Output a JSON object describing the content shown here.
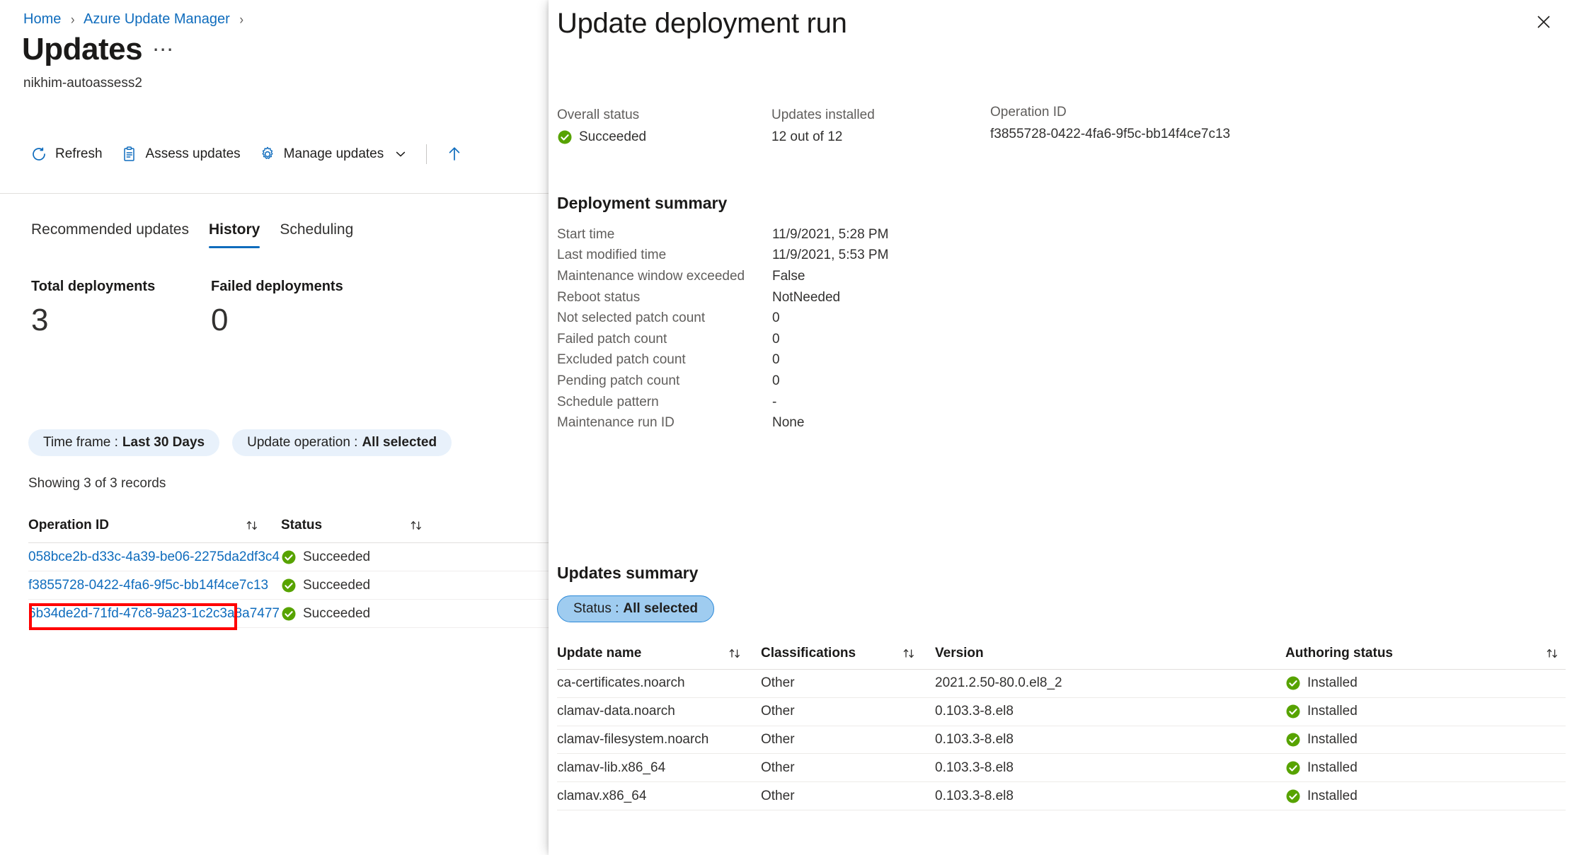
{
  "breadcrumb": {
    "items": [
      "Home",
      "Azure Update Manager"
    ],
    "separator": "›"
  },
  "page": {
    "title": "Updates",
    "ellipsis": "⋯",
    "subtitle": "nikhim-autoassess2"
  },
  "command_bar": {
    "refresh": "Refresh",
    "assess_updates": "Assess updates",
    "manage_updates": "Manage updates"
  },
  "tabs": [
    {
      "label": "Recommended updates",
      "active": false
    },
    {
      "label": "History",
      "active": true
    },
    {
      "label": "Scheduling",
      "active": false
    }
  ],
  "metrics": [
    {
      "label": "Total deployments",
      "value": "3"
    },
    {
      "label": "Failed deployments",
      "value": "0"
    }
  ],
  "filters": [
    {
      "key": "Time frame :",
      "value": "Last 30 Days"
    },
    {
      "key": "Update operation :",
      "value": "All selected"
    }
  ],
  "records_text": "Showing 3 of 3 records",
  "history_table": {
    "columns": [
      "Operation ID",
      "Status"
    ],
    "rows": [
      {
        "operation_id": "058bce2b-d33c-4a39-be06-2275da2df3c4",
        "status": "Succeeded",
        "highlighted": false
      },
      {
        "operation_id": "f3855728-0422-4fa6-9f5c-bb14f4ce7c13",
        "status": "Succeeded",
        "highlighted": true
      },
      {
        "operation_id": "6b34de2d-71fd-47c8-9a23-1c2c3a8a7477",
        "status": "Succeeded",
        "highlighted": false
      }
    ]
  },
  "panel": {
    "title": "Update deployment run",
    "close_label": "Close",
    "status_strip": {
      "overall_status_label": "Overall status",
      "overall_status_value": "Succeeded",
      "updates_installed_label": "Updates installed",
      "updates_installed_value": "12 out of 12",
      "operation_id_label": "Operation ID",
      "operation_id_value": "f3855728-0422-4fa6-9f5c-bb14f4ce7c13"
    },
    "deployment_summary": {
      "heading": "Deployment summary",
      "rows": [
        {
          "key": "Start time",
          "value": "11/9/2021, 5:28 PM"
        },
        {
          "key": "Last modified time",
          "value": "11/9/2021, 5:53 PM"
        },
        {
          "key": "Maintenance window exceeded",
          "value": "False"
        },
        {
          "key": "Reboot status",
          "value": "NotNeeded"
        },
        {
          "key": "Not selected patch count",
          "value": "0"
        },
        {
          "key": "Failed patch count",
          "value": "0"
        },
        {
          "key": "Excluded patch count",
          "value": "0"
        },
        {
          "key": "Pending patch count",
          "value": "0"
        },
        {
          "key": "Schedule pattern",
          "value": "-"
        },
        {
          "key": "Maintenance run ID",
          "value": "None"
        }
      ]
    },
    "updates_summary": {
      "heading": "Updates summary",
      "filter": {
        "key": "Status :",
        "value": "All selected"
      },
      "columns": [
        "Update name",
        "Classifications",
        "Version",
        "Authoring status"
      ],
      "rows": [
        {
          "name": "ca-certificates.noarch",
          "classification": "Other",
          "version": "2021.2.50-80.0.el8_2",
          "authoring_status": "Installed"
        },
        {
          "name": "clamav-data.noarch",
          "classification": "Other",
          "version": "0.103.3-8.el8",
          "authoring_status": "Installed"
        },
        {
          "name": "clamav-filesystem.noarch",
          "classification": "Other",
          "version": "0.103.3-8.el8",
          "authoring_status": "Installed"
        },
        {
          "name": "clamav-lib.x86_64",
          "classification": "Other",
          "version": "0.103.3-8.el8",
          "authoring_status": "Installed"
        },
        {
          "name": "clamav.x86_64",
          "classification": "Other",
          "version": "0.103.3-8.el8",
          "authoring_status": "Installed"
        }
      ]
    }
  },
  "icons": {
    "refresh": "refresh-icon",
    "clipboard": "clipboard-icon",
    "gear": "gear-icon",
    "chevron_down": "chevron-down-icon",
    "upload_arrow": "upload-arrow-icon",
    "sort": "sort-icon",
    "success_check": "success-check-icon",
    "close": "close-icon"
  },
  "colors": {
    "accent_blue": "#0f6cbd",
    "link_blue": "#0f6cbd",
    "success_green": "#57a300",
    "pill_bg": "#e8f1fb",
    "pill_selected_bg": "#9fccf0",
    "pill_selected_border": "#2b88d8",
    "highlight_red": "#ff0000"
  }
}
